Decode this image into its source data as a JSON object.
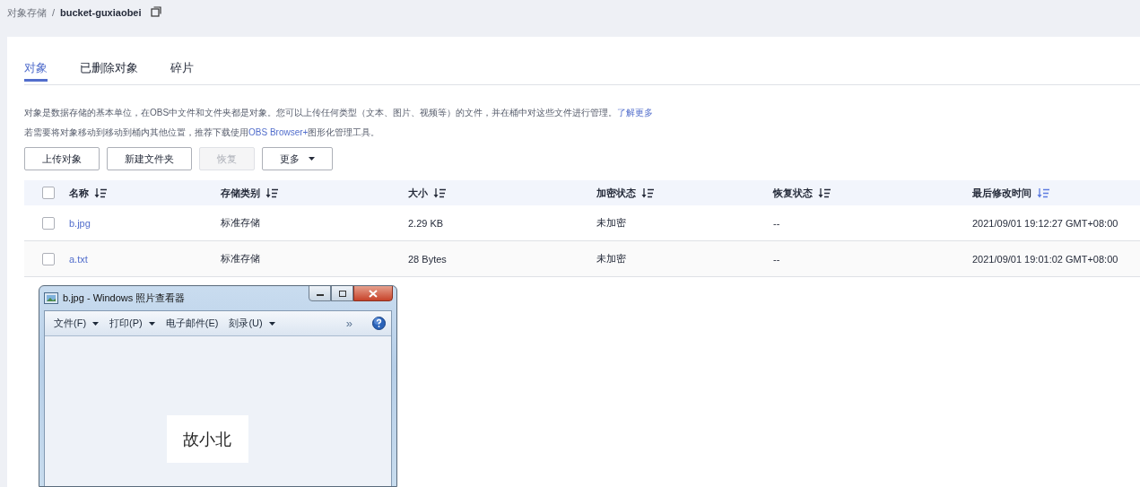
{
  "breadcrumb": {
    "items": [
      {
        "label": "对象存储",
        "current": false
      },
      {
        "label": "bucket-guxiaobei",
        "current": true
      }
    ],
    "separator": "/"
  },
  "tabs": [
    {
      "label": "对象",
      "selected": true
    },
    {
      "label": "已删除对象",
      "selected": false
    },
    {
      "label": "碎片",
      "selected": false
    }
  ],
  "description": [
    {
      "parts": [
        {
          "text": "对象是数据存储的基本单位，在OBS中文件和文件夹都是对象。您可以上传任何类型（文本、图片、视频等）的文件，并在桶中对这些文件进行管理。",
          "link": false
        },
        {
          "text": "了解更多",
          "link": true
        }
      ]
    },
    {
      "parts": [
        {
          "text": "若需要将对象移动到移动到桶内其他位置，推荐下载使用",
          "link": false
        },
        {
          "text": "OBS Browser+",
          "link": true
        },
        {
          "text": "图形化管理工具。",
          "link": false
        }
      ]
    }
  ],
  "buttons": [
    {
      "label": "上传对象",
      "disabled": false,
      "dropdown": false
    },
    {
      "label": "新建文件夹",
      "disabled": false,
      "dropdown": false
    },
    {
      "label": "恢复",
      "disabled": true,
      "dropdown": false
    },
    {
      "label": "更多",
      "disabled": false,
      "dropdown": true
    }
  ],
  "table": {
    "select_all_checked": false,
    "columns": [
      {
        "label": "名称",
        "sort_active": false
      },
      {
        "label": "存储类别",
        "sort_active": false
      },
      {
        "label": "大小",
        "sort_active": false
      },
      {
        "label": "加密状态",
        "sort_active": false
      },
      {
        "label": "恢复状态",
        "sort_active": false
      },
      {
        "label": "最后修改时间",
        "sort_active": true
      }
    ],
    "rows": [
      {
        "checked": false,
        "cells": [
          "b.jpg",
          "标准存储",
          "2.29 KB",
          "未加密",
          "--",
          "2021/09/01 19:12:27 GMT+08:00"
        ]
      },
      {
        "checked": false,
        "cells": [
          "a.txt",
          "标准存储",
          "28 Bytes",
          "未加密",
          "--",
          "2021/09/01 19:01:02 GMT+08:00"
        ]
      }
    ]
  },
  "viewer": {
    "title": "b.jpg - Windows 照片查看器",
    "menu": [
      {
        "label": "文件(F)",
        "dropdown": true
      },
      {
        "label": "打印(P)",
        "dropdown": true
      },
      {
        "label": "电子邮件(E)",
        "dropdown": false
      },
      {
        "label": "刻录(U)",
        "dropdown": true
      }
    ],
    "overflow": "»",
    "image_text": "故小北"
  }
}
